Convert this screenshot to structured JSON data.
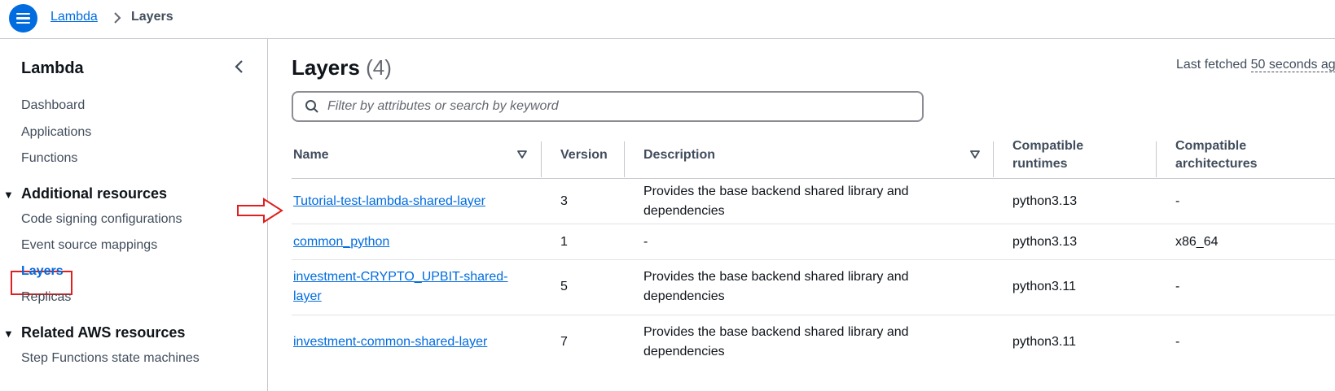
{
  "topbar": {
    "breadcrumb_root": "Lambda",
    "breadcrumb_current": "Layers"
  },
  "sidebar": {
    "title": "Lambda",
    "items": [
      "Dashboard",
      "Applications",
      "Functions"
    ],
    "section_additional": "Additional resources",
    "additional_items": [
      "Code signing configurations",
      "Event source mappings",
      "Layers",
      "Replicas"
    ],
    "section_related": "Related AWS resources",
    "related_items": [
      "Step Functions state machines"
    ]
  },
  "main": {
    "title": "Layers",
    "count": "(4)",
    "last_fetched_label": "Last fetched",
    "last_fetched_value": "50 seconds ag",
    "search_placeholder": "Filter by attributes or search by keyword",
    "columns": {
      "name": "Name",
      "version": "Version",
      "description": "Description",
      "runtimes_1": "Compatible",
      "runtimes_2": "runtimes",
      "arch_1": "Compatible",
      "arch_2": "architectures"
    },
    "rows": [
      {
        "name_1": "Tutorial-test-lambda-shared-layer",
        "name_2": "",
        "version": "3",
        "desc_1": "Provides the base backend shared library and",
        "desc_2": "dependencies",
        "runtime": "python3.13",
        "arch": "-"
      },
      {
        "name_1": "common_python",
        "name_2": "",
        "version": "1",
        "desc_1": "-",
        "desc_2": "",
        "runtime": "python3.13",
        "arch": "x86_64"
      },
      {
        "name_1": "investment-CRYPTO_UPBIT-shared-",
        "name_2": "layer",
        "version": "5",
        "desc_1": "Provides the base backend shared library and",
        "desc_2": "dependencies",
        "runtime": "python3.11",
        "arch": "-"
      },
      {
        "name_1": "investment-common-shared-layer",
        "name_2": "",
        "version": "7",
        "desc_1": "Provides the base backend shared library and",
        "desc_2": "dependencies",
        "runtime": "python3.11",
        "arch": "-"
      }
    ]
  },
  "colors": {
    "accent": "#006ce0",
    "highlight": "#e02020"
  }
}
